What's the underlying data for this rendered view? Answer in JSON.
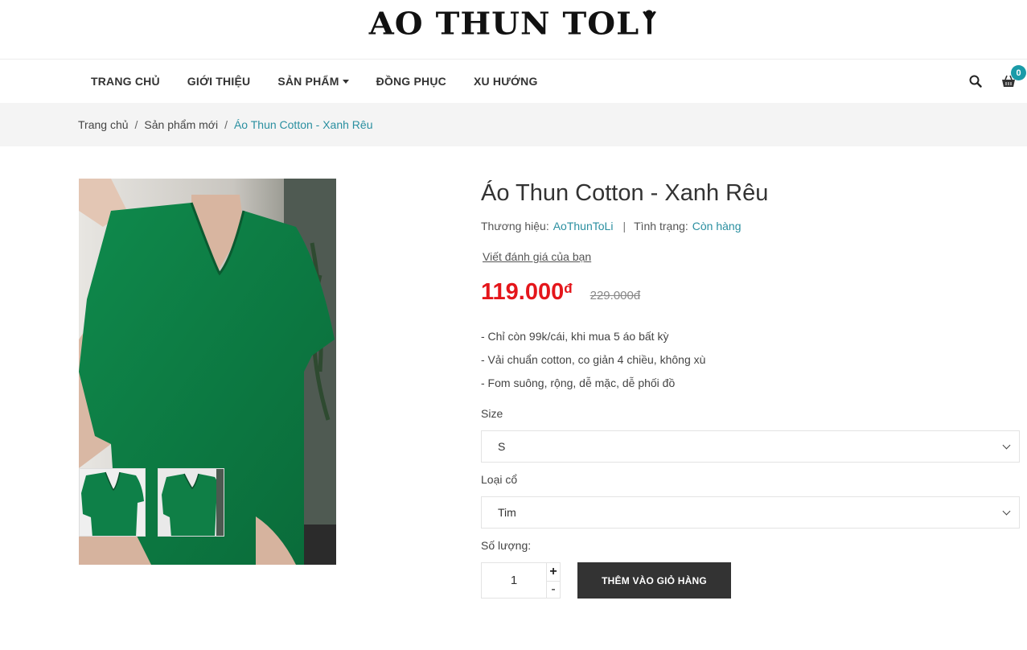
{
  "site": {
    "logo_text": "AO THUN TOL"
  },
  "nav": {
    "items": [
      {
        "label": "TRANG CHỦ"
      },
      {
        "label": "GIỚI THIỆU"
      },
      {
        "label": "SẢN PHẨM"
      },
      {
        "label": "ĐỒNG PHỤC"
      },
      {
        "label": "XU HƯỚNG"
      }
    ],
    "cart_count": "0",
    "accent_color": "#1a9ba8"
  },
  "breadcrumb": {
    "home": "Trang chủ",
    "category": "Sản phẩm mới",
    "current": "Áo Thun Cotton - Xanh Rêu"
  },
  "product": {
    "title": "Áo Thun Cotton - Xanh Rêu",
    "brand_label": "Thương hiệu:",
    "brand": "AoThunToLi",
    "status_label": "Tình trạng:",
    "status": "Còn hàng",
    "review_link": "Viết đánh giá của bạn",
    "price": "119.000",
    "currency": "đ",
    "old_price": "229.000đ",
    "price_color": "#e4161b",
    "description": [
      "- Chỉ còn 99k/cái, khi mua 5 áo bất kỳ",
      "- Vải chuẩn cotton, co giản 4 chiều, không xù",
      "- Fom suông, rộng, dễ mặc, dễ phối đồ"
    ],
    "size_label": "Size",
    "size_value": "S",
    "collar_label": "Loại cổ",
    "collar_value": "Tim",
    "qty_label": "Số lượng:",
    "qty_value": "1",
    "qty_plus": "+",
    "qty_minus": "-",
    "add_to_cart": "THÊM VÀO GIỎ HÀNG",
    "shirt_color": "#0d7a44"
  }
}
